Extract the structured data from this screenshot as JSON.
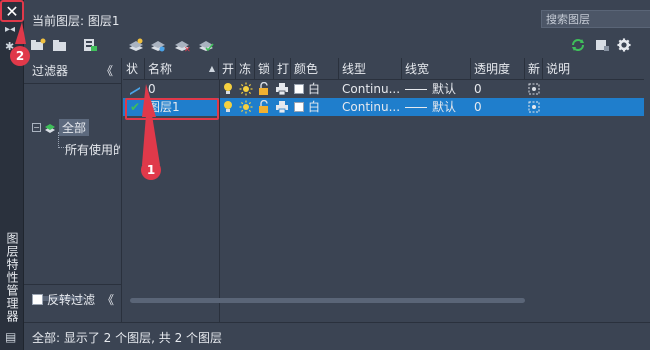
{
  "window": {
    "close_glyph": "✕",
    "vertical_title": "图层特性管理器"
  },
  "header": {
    "current_layer": "当前图层: 图层1",
    "search_placeholder": "搜索图层"
  },
  "filter_panel": {
    "title": "过滤器",
    "collapse_glyph": "《",
    "tree": {
      "expander": "⊟",
      "all": "全部",
      "used": "所有使用的图层"
    },
    "invert_label": "反转过滤",
    "invert_collapse_glyph": "《"
  },
  "table": {
    "columns": [
      "状",
      "名称",
      "开",
      "冻",
      "锁",
      "打",
      "颜色",
      "线型",
      "线宽",
      "透明度",
      "新",
      "说明"
    ],
    "rows": [
      {
        "status": "",
        "name": "0",
        "color": "白",
        "linetype": "Continu...",
        "lineweight": "默认",
        "transparency": "0",
        "selected": false
      },
      {
        "status": "✔",
        "name": "图层1",
        "color": "白",
        "linetype": "Continu...",
        "lineweight": "默认",
        "transparency": "0",
        "selected": true
      }
    ]
  },
  "callouts": {
    "one": "1",
    "two": "2"
  },
  "status_bar": {
    "text": "全部: 显示了 2 个图层, 共 2 个图层"
  },
  "colors": {
    "background": "#3b4453",
    "selection": "#1f7ecc",
    "callout": "#e0394a",
    "refresh_green": "#3fbf5a"
  },
  "icons": [
    "close-icon",
    "pin-icon",
    "settings-icon",
    "new-filter-icon",
    "group-filter-icon",
    "state-manager-icon",
    "new-layer-icon",
    "new-vp-layer-icon",
    "delete-layer-icon",
    "set-current-icon",
    "refresh-icon",
    "settings-gear-icon",
    "search-icon",
    "lightbulb-icon",
    "sun-icon",
    "unlock-icon",
    "printer-icon",
    "new-vp-freeze-icon"
  ]
}
